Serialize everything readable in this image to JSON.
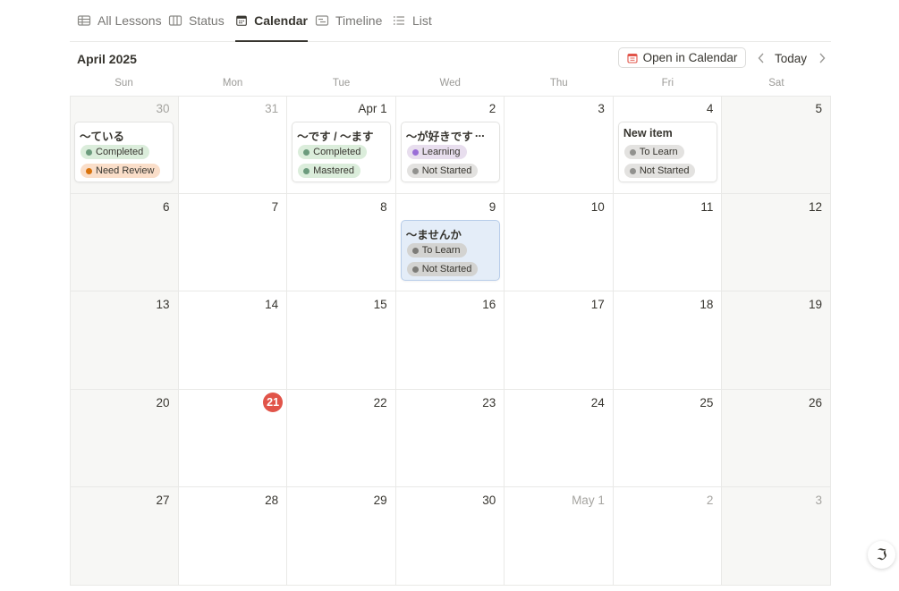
{
  "tabs": [
    {
      "label": "All Lessons",
      "icon": "table-icon",
      "active": false
    },
    {
      "label": "Status",
      "icon": "board-icon",
      "active": false
    },
    {
      "label": "Calendar",
      "icon": "calendar-icon",
      "active": true
    },
    {
      "label": "Timeline",
      "icon": "timeline-icon",
      "active": false
    },
    {
      "label": "List",
      "icon": "list-icon",
      "active": false
    }
  ],
  "header": {
    "month": "April 2025",
    "open_in_calendar": "Open in Calendar",
    "today": "Today"
  },
  "weekdays": [
    "Sun",
    "Mon",
    "Tue",
    "Wed",
    "Thu",
    "Fri",
    "Sat"
  ],
  "colors": {
    "today_badge": "#e15449",
    "selected_card": "#e4edf8"
  },
  "days": [
    {
      "label": "30",
      "muted": true
    },
    {
      "label": "31",
      "muted": true
    },
    {
      "label": "Apr 1",
      "muted": false
    },
    {
      "label": "2",
      "muted": false
    },
    {
      "label": "3",
      "muted": false
    },
    {
      "label": "4",
      "muted": false
    },
    {
      "label": "5",
      "muted": false
    },
    {
      "label": "6",
      "muted": false
    },
    {
      "label": "7",
      "muted": false
    },
    {
      "label": "8",
      "muted": false
    },
    {
      "label": "9",
      "muted": false
    },
    {
      "label": "10",
      "muted": false
    },
    {
      "label": "11",
      "muted": false
    },
    {
      "label": "12",
      "muted": false
    },
    {
      "label": "13",
      "muted": false
    },
    {
      "label": "14",
      "muted": false
    },
    {
      "label": "15",
      "muted": false
    },
    {
      "label": "16",
      "muted": false
    },
    {
      "label": "17",
      "muted": false
    },
    {
      "label": "18",
      "muted": false
    },
    {
      "label": "19",
      "muted": false
    },
    {
      "label": "20",
      "muted": false
    },
    {
      "label": "21",
      "muted": false,
      "today": true
    },
    {
      "label": "22",
      "muted": false
    },
    {
      "label": "23",
      "muted": false
    },
    {
      "label": "24",
      "muted": false
    },
    {
      "label": "25",
      "muted": false
    },
    {
      "label": "26",
      "muted": false
    },
    {
      "label": "27",
      "muted": false
    },
    {
      "label": "28",
      "muted": false
    },
    {
      "label": "29",
      "muted": false
    },
    {
      "label": "30",
      "muted": false
    },
    {
      "label": "May 1",
      "muted": true
    },
    {
      "label": "2",
      "muted": true
    },
    {
      "label": "3",
      "muted": true
    }
  ],
  "events": [
    {
      "day_index": 0,
      "title": "〜ている",
      "more": "",
      "selected": false,
      "tags": [
        {
          "label": "Completed",
          "bg": "#dbeddb",
          "dot": "#6c9b7d"
        },
        {
          "label": "Need Review",
          "bg": "#fadec9",
          "dot": "#d9730d"
        }
      ]
    },
    {
      "day_index": 2,
      "title": "〜です / 〜ます",
      "more": "",
      "selected": false,
      "tags": [
        {
          "label": "Completed",
          "bg": "#dbeddb",
          "dot": "#6c9b7d"
        },
        {
          "label": "Mastered",
          "bg": "#dbeddb",
          "dot": "#6c9b7d"
        }
      ]
    },
    {
      "day_index": 3,
      "title": "〜が好きです",
      "more": "...",
      "selected": false,
      "tags": [
        {
          "label": "Learning",
          "bg": "#e8deee",
          "dot": "#9a6dd7"
        },
        {
          "label": "Not Started",
          "bg": "#e3e2e0",
          "dot": "#91918e"
        }
      ]
    },
    {
      "day_index": 5,
      "title": "New item",
      "more": "",
      "selected": false,
      "tags": [
        {
          "label": "To Learn",
          "bg": "#e3e2e0",
          "dot": "#91918e"
        },
        {
          "label": "Not Started",
          "bg": "#e3e2e0",
          "dot": "#91918e"
        }
      ]
    },
    {
      "day_index": 10,
      "title": "〜ませんか",
      "more": "",
      "selected": true,
      "tags": [
        {
          "label": "To Learn",
          "bg": "#d3d3d1",
          "dot": "#7d7c78"
        },
        {
          "label": "Not Started",
          "bg": "#d3d3d1",
          "dot": "#7d7c78"
        }
      ]
    }
  ],
  "fab": {
    "icon": "feedback-icon",
    "glyph": "ℑ"
  }
}
